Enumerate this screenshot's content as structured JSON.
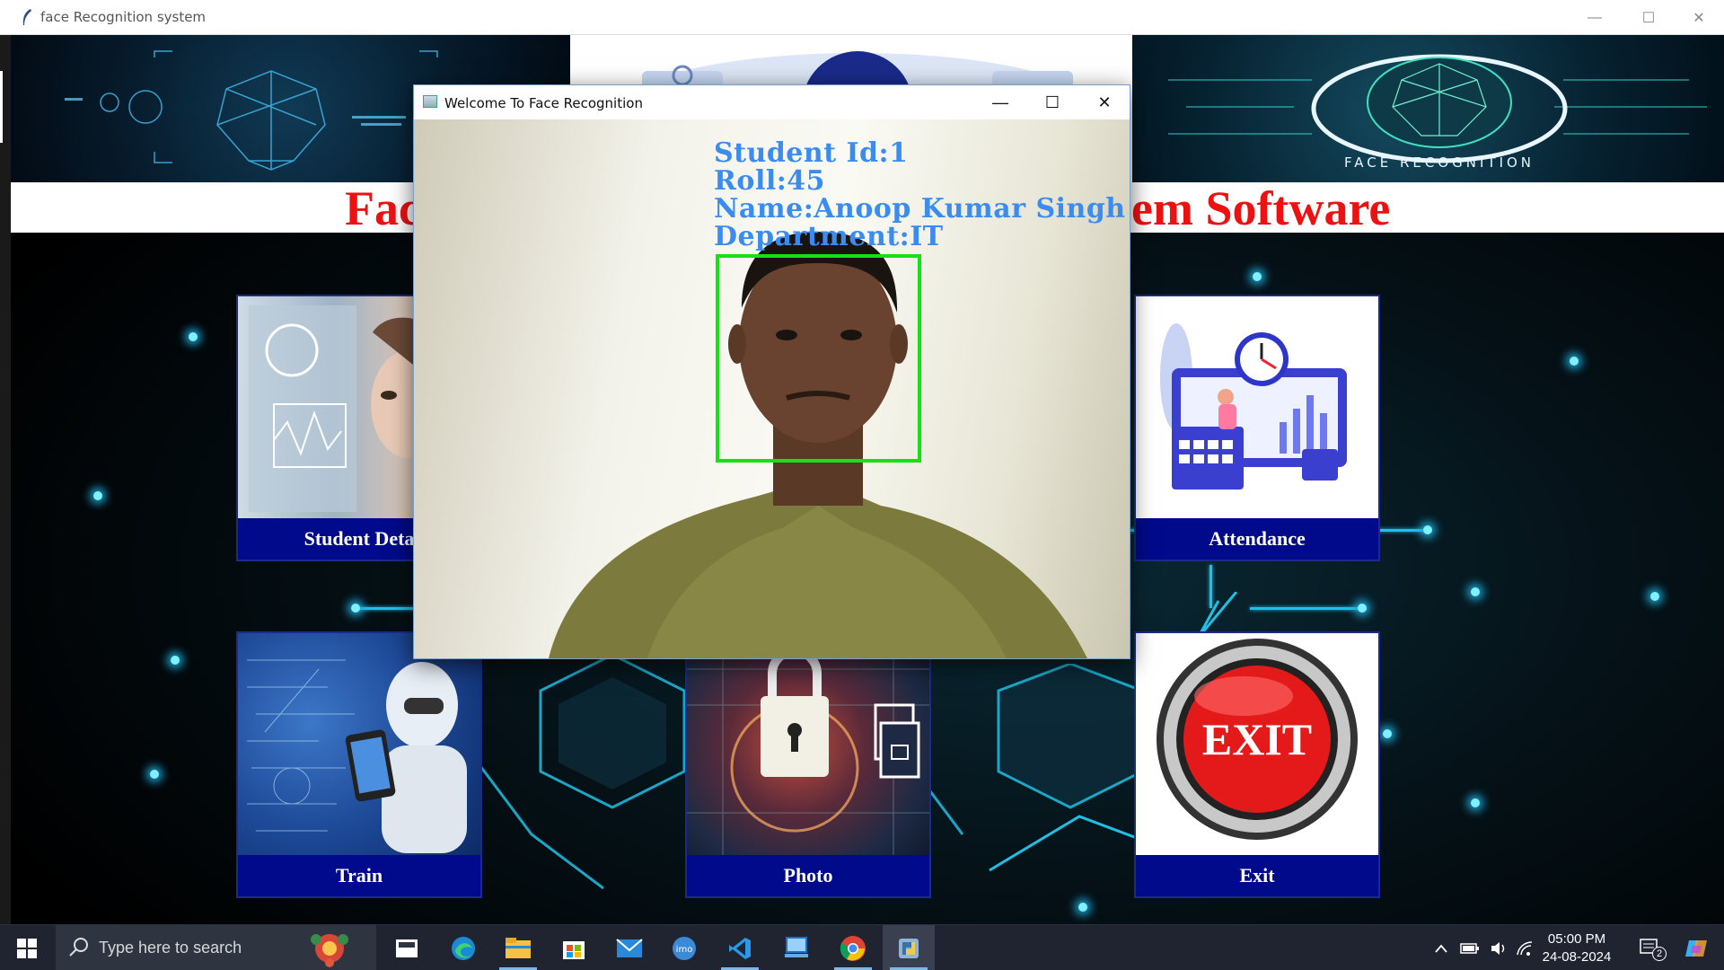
{
  "main_window": {
    "title": "face Recognition system",
    "heading_left": "Fac",
    "heading_right": "em Software"
  },
  "cards": {
    "student": {
      "label": "Student Deta"
    },
    "attendance": {
      "label": "Attendance"
    },
    "train": {
      "label": "Train"
    },
    "photo": {
      "label": "Photo"
    },
    "exit": {
      "label": "Exit",
      "image_text": "EXIT"
    }
  },
  "banner": {
    "right_caption": "FACE  RECOGNITION"
  },
  "popup": {
    "title": "Welcome To Face Recognition",
    "overlay": {
      "student_id": "Student Id:1",
      "roll": "Roll:45",
      "name": "Name:Anoop Kumar Singh",
      "department": "Department:IT"
    }
  },
  "taskbar": {
    "search_placeholder": "Type here to search",
    "time": "05:00 PM",
    "date": "24-08-2024",
    "notification_count": "2",
    "apps": [
      "task-view",
      "edge",
      "file-explorer",
      "store",
      "mail",
      "imo",
      "vscode",
      "remote-desktop",
      "chrome",
      "python"
    ]
  },
  "colors": {
    "title_red": "#ee1111",
    "card_label_bg": "#010a8a",
    "overlay_blue": "#3b8cf0",
    "face_box_green": "#16e016"
  }
}
